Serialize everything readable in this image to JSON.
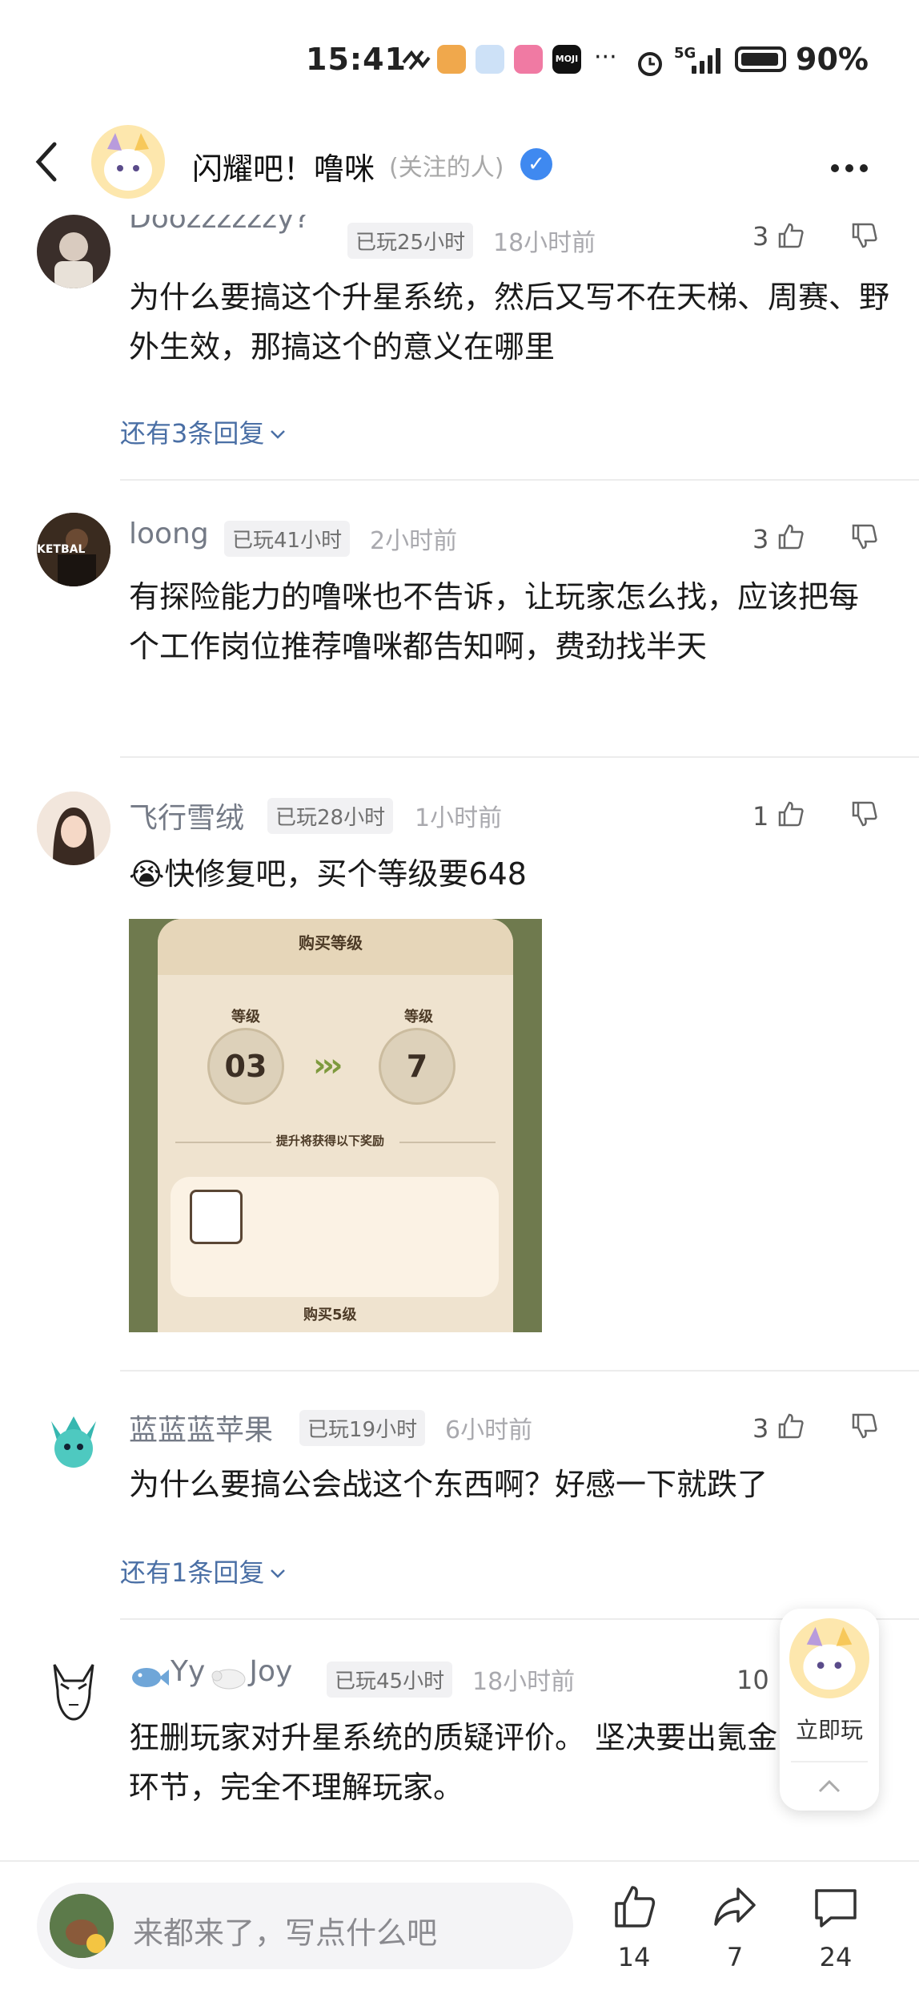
{
  "status_bar": {
    "time": "15:41",
    "network": "5G",
    "battery": "90%"
  },
  "header": {
    "app_name": "闪耀吧！噜咪",
    "follow_tag": "(关注的人)",
    "verified_mark": "✓"
  },
  "comments": [
    {
      "name": "Doozzzzzzy?",
      "played": "已玩25小时",
      "time": "18小时前",
      "likes": "3",
      "text": "为什么要搞这个升星系统，然后又写不在天梯、周赛、野外生效，那搞这个的意义在哪里",
      "replies_link": "还有3条回复"
    },
    {
      "name": "loong",
      "played": "已玩41小时",
      "time": "2小时前",
      "likes": "3",
      "text": "有探险能力的噜咪也不告诉，让玩家怎么找，应该把每个工作岗位推荐噜咪都告知啊，费劲找半天",
      "avatar_text": "KETBAL"
    },
    {
      "name": "飞行雪绒",
      "played": "已玩28小时",
      "time": "1小时前",
      "likes": "1",
      "emoji": "😭",
      "text": "快修复吧，买个等级要648",
      "image": {
        "title": "购买等级",
        "level_label_left": "等级",
        "level_from": "03",
        "level_label_right": "等级",
        "level_to": "7",
        "reward_text": "提升将获得以下奖励",
        "button": "购买5级"
      }
    },
    {
      "name": "蓝蓝蓝苹果",
      "played": "已玩19小时",
      "time": "6小时前",
      "likes": "3",
      "text": "为什么要搞公会战这个东西啊？好感一下就跌了",
      "replies_link": "还有1条回复"
    },
    {
      "name_part1": "Yy",
      "name_part2": "Joy",
      "played": "已玩45小时",
      "time": "18小时前",
      "likes": "10",
      "text": "狂删玩家对升星系统的质疑评价。 坚决要出氪金环节，完全不理解玩家。"
    }
  ],
  "floating": {
    "play_label": "立即玩"
  },
  "bottom_bar": {
    "placeholder": "来都来了，写点什么吧",
    "likes": "14",
    "shares": "7",
    "comments": "24"
  },
  "colors": {
    "accent_blue": "#3f89f0",
    "link": "#4a6fa5",
    "meta": "#a9a9ae"
  }
}
